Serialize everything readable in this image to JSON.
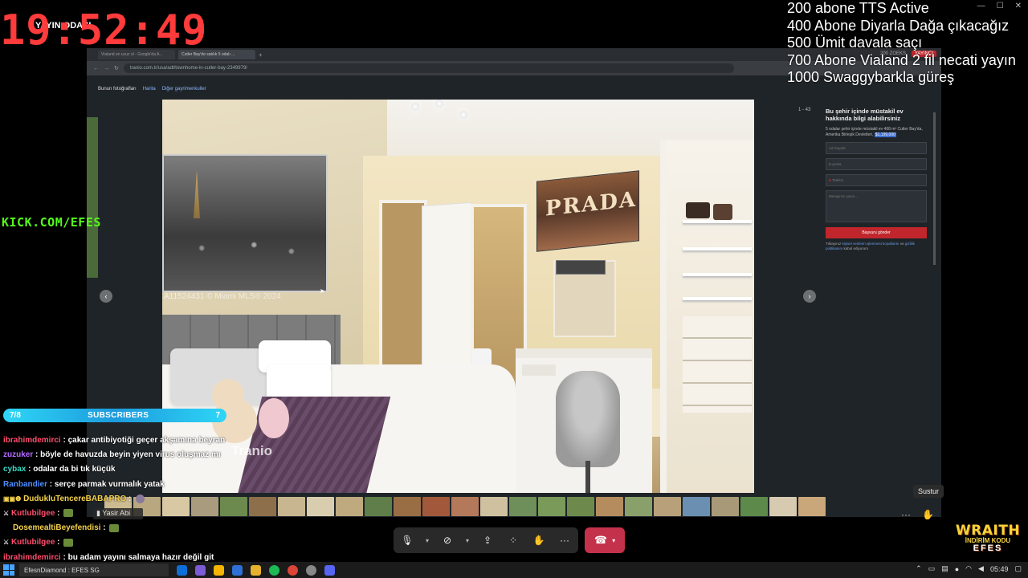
{
  "overlay": {
    "clock": "19:52:49",
    "room_label": "YAYIN ODASI",
    "kick_url": "KICK.COM/EFES",
    "goals": [
      "200 abone TTS Active",
      "400 Abone Diyarla Dağa çıkacağız",
      "500 Ümit davala saçı",
      "700 Abone Vialand 2 fil necati yayın",
      "1000 Swaggybarkla güreş"
    ],
    "subscribers": {
      "left": "7/8",
      "label": "SUBSCRIBERS",
      "right": "7"
    }
  },
  "chat": [
    {
      "user": "ibrahimdemirci",
      "user_color": "#ff4d6d",
      "message": "çakar antibiyotiği geçer akşamına beyran"
    },
    {
      "user": "zuzuker",
      "user_color": "#b36bff",
      "message": "böyle de havuzda beyin yiyen virus oluşmaz mı"
    },
    {
      "user": "cybax",
      "user_color": "#3ad8c4",
      "message": "odalar da bi tık küçük"
    },
    {
      "user": "Ranbandier",
      "user_color": "#4f8dff",
      "message": "serçe parmak vurmalık yatak"
    },
    {
      "user": "DudukluTencereBABAPRO",
      "user_color": "#f5d24b",
      "message": "",
      "badges": true,
      "avatar": true
    },
    {
      "user": "Kutlubilgee",
      "user_color": "#ff4d6d",
      "message": "",
      "emote": true
    },
    {
      "user": "DosemealtiBeyefendisi",
      "user_color": "#f5d24b",
      "message": "",
      "emote": true
    },
    {
      "user": "Kutlubilgee",
      "user_color": "#ff4d6d",
      "message": "",
      "emote": true
    },
    {
      "user": "ibrahimdemirci",
      "user_color": "#ff4d6d",
      "message": "bu adam yayını salmaya hazır değil git"
    }
  ],
  "speaker_label": "Yasir Abi",
  "shared_screen": {
    "tabs": [
      "Vialand en ucuz ol - Google'da A...",
      "Cutler Bay'de satılık 5 odalı ..."
    ],
    "url": "tranio.com.tr/usa/adt/townhome-in-cutler-bay-2349979/",
    "site_nav": [
      "Bunun fotoğrafları",
      "Harita",
      "Diğer gayrimenkuller"
    ],
    "top_link": "200 ZOEKS",
    "top_button": "YAYINCI",
    "photo_counter": "1 - 43",
    "watermark": "A11524431 © Miami MLS® 2024",
    "photo_brand": "Tranio",
    "painting_text": "PRADA",
    "form": {
      "title": "Bu şehir içinde müstakil ev hakkında bilgi alabilirsiniz",
      "desc_prefix": "5 odalar şehir içinde müstakil ev 468 m² Cutler Bay'da, Amerika Birleşik Devletleri,",
      "price": "$1,199,000",
      "name_placeholder": "Ad Soyadı",
      "email_placeholder": "E-posta",
      "phone_placeholder": "Telefon",
      "message_placeholder": "Mesajınızı yazın...",
      "submit": "Başvuru gönder",
      "note_prefix": "Tıklayınız",
      "note_link1": "kişisel verilerin işlenmesi koşullarını",
      "note_mid": "ve",
      "note_link2": "gizlilik politikasını",
      "note_suffix": "kabul ediyorum"
    }
  },
  "tooltip": "Sustur",
  "icons": {
    "mic": "microphone-icon",
    "camera": "camera-off-icon",
    "share": "share-screen-icon",
    "apps": "apps-icon",
    "raise": "raise-hand-icon",
    "more": "more-icon",
    "hangup": "hang-up-icon"
  },
  "wraith": {
    "title": "WRAITH",
    "sub": "İNDİRİM KODU",
    "code": "EFES"
  },
  "taskbar": {
    "now_playing": "EfesnDiamond : EFES SG",
    "time": "05:49"
  },
  "colors": {
    "hangup": "#c4314b",
    "kick": "#53fc18",
    "clock": "#ff3b3b"
  }
}
